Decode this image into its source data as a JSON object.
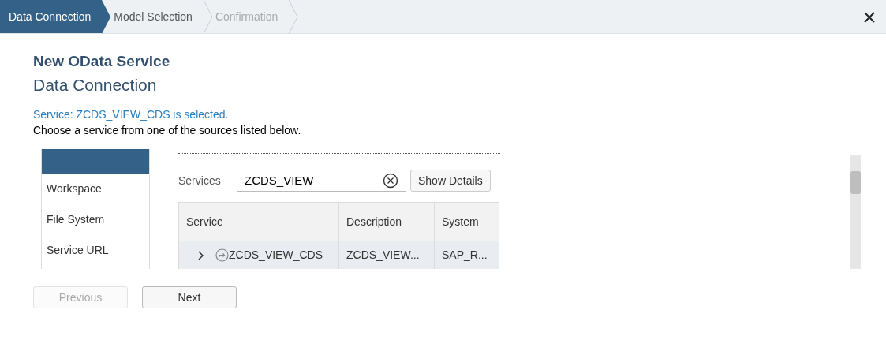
{
  "steps": [
    {
      "label": "Data Connection",
      "selected": true,
      "disabled": false
    },
    {
      "label": "Model Selection",
      "selected": false,
      "disabled": false
    },
    {
      "label": "Confirmation",
      "selected": false,
      "disabled": true
    }
  ],
  "heading": "New OData Service",
  "subheading": "Data Connection",
  "status_message": "Service: ZCDS_VIEW_CDS is selected.",
  "instruction": "Choose a service from one of the sources listed below.",
  "sources": [
    {
      "selected": true
    },
    {
      "label": "Workspace",
      "selected": false
    },
    {
      "label": "File System",
      "selected": false
    },
    {
      "label": "Service URL",
      "selected": false
    }
  ],
  "services_label": "Services",
  "search": {
    "value": "ZCDS_VIEW"
  },
  "show_details_button": "Show Details",
  "table": {
    "columns": [
      "Service",
      "Description",
      "System"
    ],
    "rows": [
      {
        "cells": [
          "ZCDS_VIEW_CDS",
          "ZCDS_VIEW...",
          "SAP_R..."
        ],
        "expanded": false,
        "selected": true
      }
    ]
  },
  "buttons": [
    {
      "label": "Previous",
      "disabled": true
    },
    {
      "label": "Next",
      "disabled": false
    }
  ]
}
